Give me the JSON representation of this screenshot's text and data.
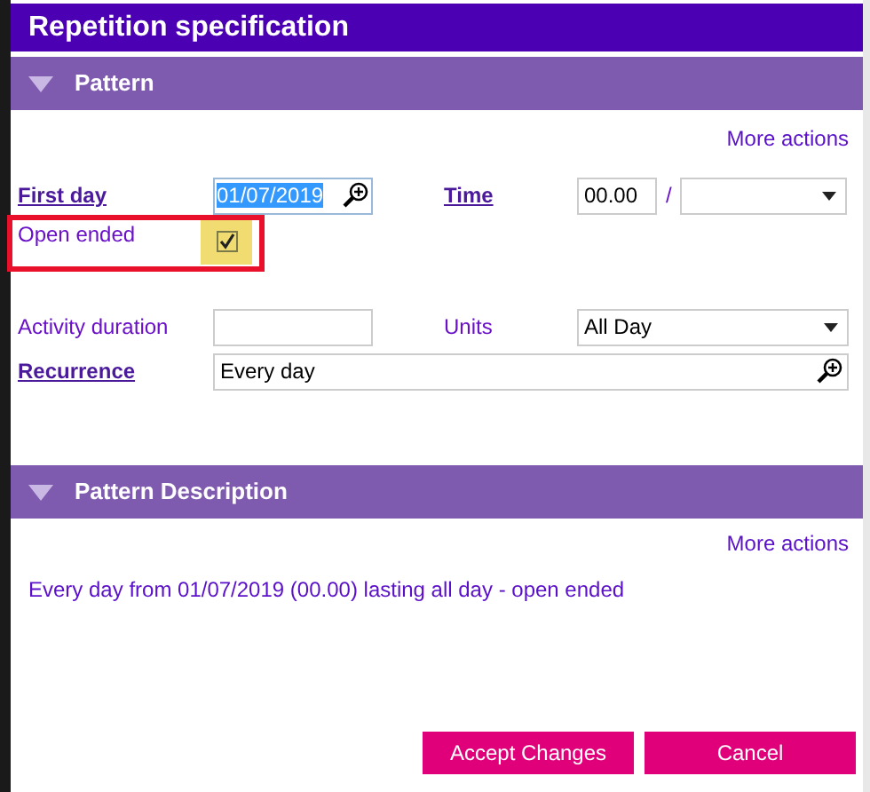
{
  "window": {
    "title": "Repetition specification"
  },
  "pattern": {
    "title": "Pattern",
    "expanded": true,
    "more_actions": "More actions",
    "first_day": {
      "label": "First day",
      "value": "01/07/2019",
      "text_selected": true
    },
    "time": {
      "label": "Time",
      "value": "00.00",
      "separator": "/"
    },
    "open_ended": {
      "label": "Open ended",
      "checked": true,
      "focused": true
    },
    "activity_duration": {
      "label": "Activity duration"
    },
    "units": {
      "label": "Units",
      "value": "All Day"
    },
    "recurrence": {
      "label": "Recurrence",
      "value": "Every day"
    }
  },
  "pattern_description": {
    "title": "Pattern Description",
    "expanded": true,
    "more_actions": "More actions",
    "text": "Every day from 01/07/2019 (00.00) lasting all day - open ended"
  },
  "buttons": [
    {
      "label": "Accept Changes"
    },
    {
      "label": "Cancel"
    }
  ]
}
